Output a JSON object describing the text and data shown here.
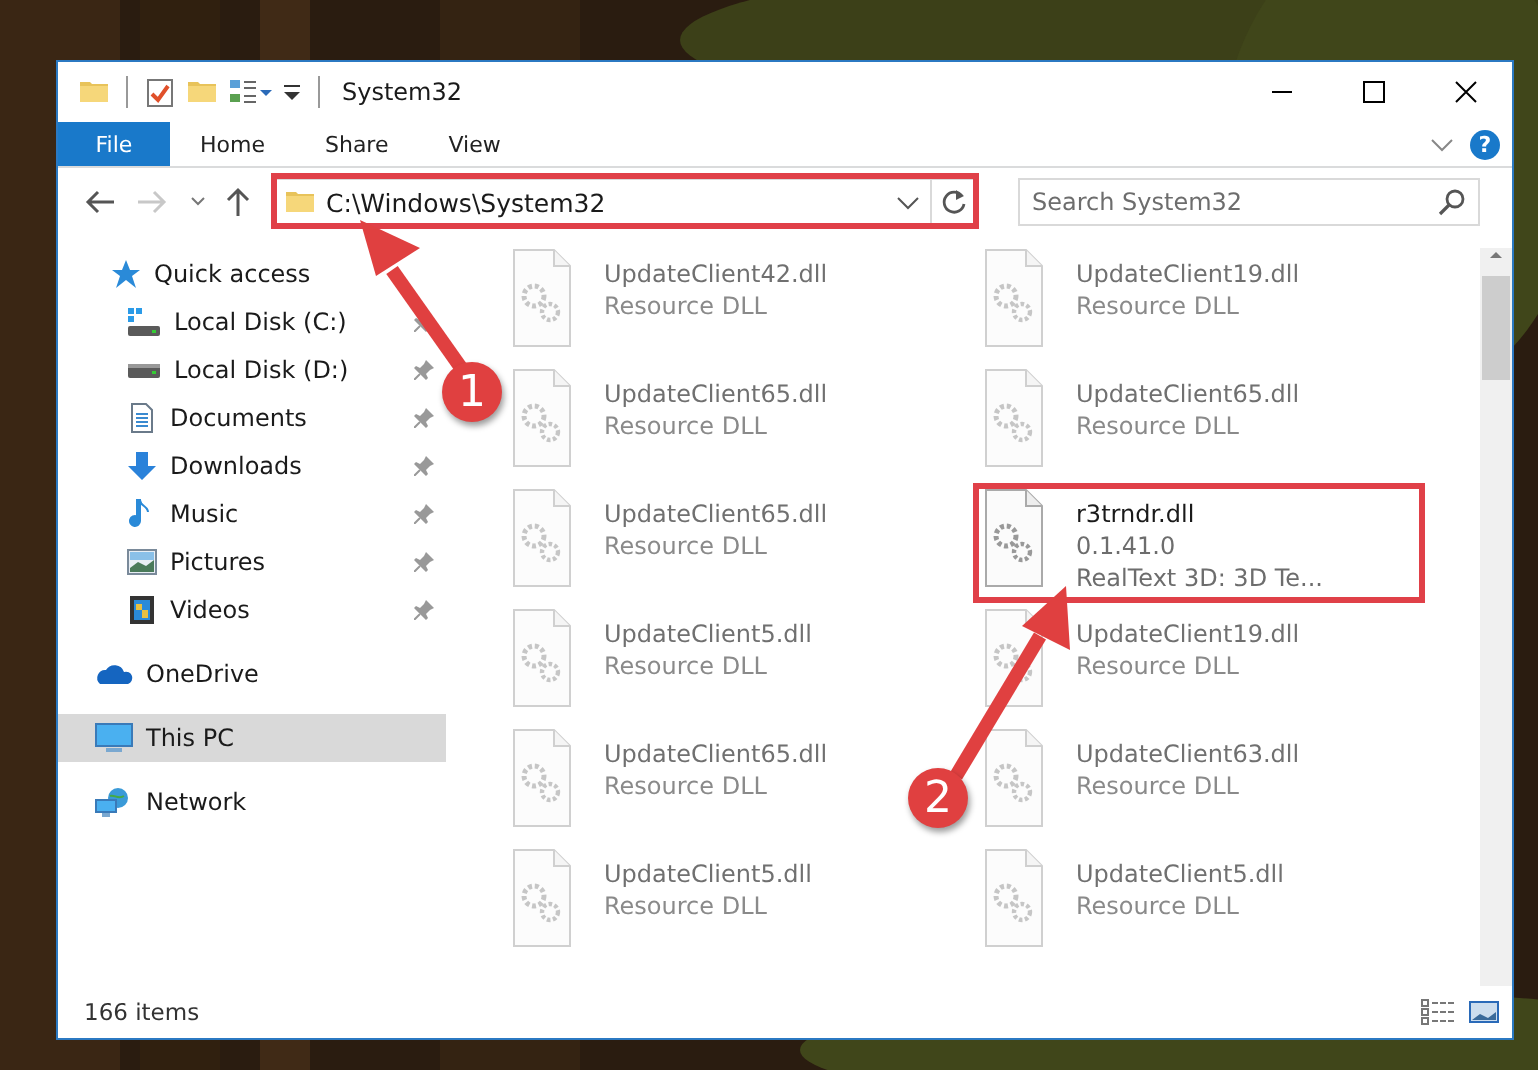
{
  "title_bar": {
    "title": "System32"
  },
  "ribbon": {
    "tabs": [
      {
        "label": "File",
        "kind": "file"
      },
      {
        "label": "Home",
        "kind": "tab"
      },
      {
        "label": "Share",
        "kind": "tab"
      },
      {
        "label": "View",
        "kind": "tab"
      }
    ],
    "help": "?"
  },
  "address_bar": {
    "path": "C:\\Windows\\System32",
    "search": {
      "placeholder": "Search System32"
    }
  },
  "sidebar": {
    "items": [
      {
        "label": "Quick access",
        "kind": "star",
        "selected": false,
        "pinned": false,
        "children": [
          {
            "label": "Local Disk (C:)",
            "kind": "drive-c",
            "selected": false,
            "pinned": true
          },
          {
            "label": "Local Disk (D:)",
            "kind": "drive",
            "selected": false,
            "pinned": true
          },
          {
            "label": "Documents",
            "kind": "documents",
            "selected": false,
            "pinned": true
          },
          {
            "label": "Downloads",
            "kind": "downloads",
            "selected": false,
            "pinned": true
          },
          {
            "label": "Music",
            "kind": "music",
            "selected": false,
            "pinned": true
          },
          {
            "label": "Pictures",
            "kind": "pictures",
            "selected": false,
            "pinned": true
          },
          {
            "label": "Videos",
            "kind": "videos",
            "selected": false,
            "pinned": true
          }
        ]
      },
      {
        "label": "OneDrive",
        "kind": "cloud",
        "selected": false,
        "pinned": false
      },
      {
        "label": "This PC",
        "kind": "computer",
        "selected": true,
        "pinned": false
      },
      {
        "label": "Network",
        "kind": "network",
        "selected": false,
        "pinned": false
      }
    ]
  },
  "files": [
    {
      "name": "UpdateClient42.dll",
      "details": [
        "Resource DLL"
      ],
      "blurred": true
    },
    {
      "name": "UpdateClient19.dll",
      "details": [
        "Resource DLL"
      ],
      "blurred": true
    },
    {
      "name": "UpdateClient65.dll",
      "details": [
        "Resource DLL"
      ],
      "blurred": true
    },
    {
      "name": "UpdateClient65.dll",
      "details": [
        "Resource DLL"
      ],
      "blurred": true
    },
    {
      "name": "UpdateClient65.dll",
      "details": [
        "Resource DLL"
      ],
      "blurred": true
    },
    {
      "name": "r3trndr.dll",
      "details": [
        "0.1.41.0",
        "RealText 3D:  3D Te..."
      ],
      "blurred": false
    },
    {
      "name": "UpdateClient5.dll",
      "details": [
        "Resource DLL"
      ],
      "blurred": true
    },
    {
      "name": "UpdateClient19.dll",
      "details": [
        "Resource DLL"
      ],
      "blurred": true
    },
    {
      "name": "UpdateClient65.dll",
      "details": [
        "Resource DLL"
      ],
      "blurred": true
    },
    {
      "name": "UpdateClient63.dll",
      "details": [
        "Resource DLL"
      ],
      "blurred": true
    },
    {
      "name": "UpdateClient5.dll",
      "details": [
        "Resource DLL"
      ],
      "blurred": true
    },
    {
      "name": "UpdateClient5.dll",
      "details": [
        "Resource DLL"
      ],
      "blurred": true
    }
  ],
  "status_bar": {
    "item_count": "166 items"
  },
  "annotations": [
    {
      "label": "1"
    },
    {
      "label": "2"
    }
  ]
}
